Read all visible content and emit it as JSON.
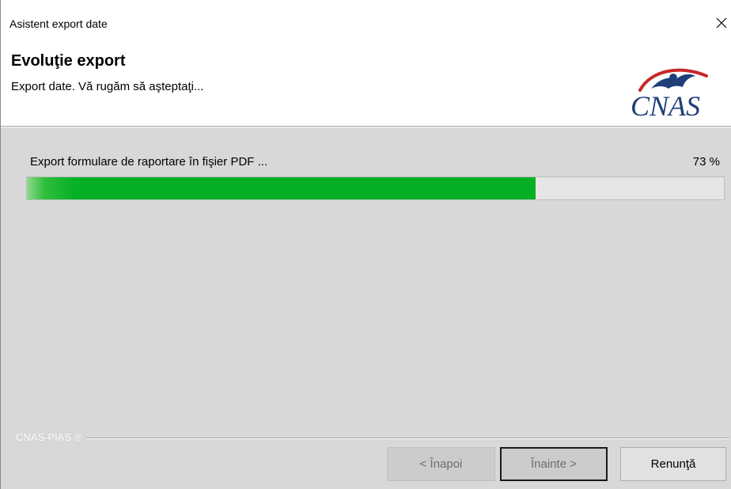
{
  "window": {
    "title": "Asistent export date",
    "close_glyph": "✕"
  },
  "header": {
    "title": "Evoluţie export",
    "subtitle": "Export date. Vă rugăm să aşteptaţi...",
    "logo_text": "CNAS",
    "logo_colors": {
      "text": "#1f3f7a",
      "arc": "#c62828",
      "bird": "#1f3f7a"
    }
  },
  "progress": {
    "status_text": "Export formulare de raportare în fişier PDF ...",
    "percent_label": "73 %",
    "value": 0.73,
    "fill_color": "#06b025"
  },
  "footer": {
    "brand_text": "CNAS-PIAS ®",
    "buttons": {
      "back_label": "< Înapoi",
      "next_label": "Înainte >",
      "cancel_label": "Renunţă"
    }
  },
  "icons": {
    "close": "close-icon",
    "logo": "cnas-logo-icon"
  }
}
